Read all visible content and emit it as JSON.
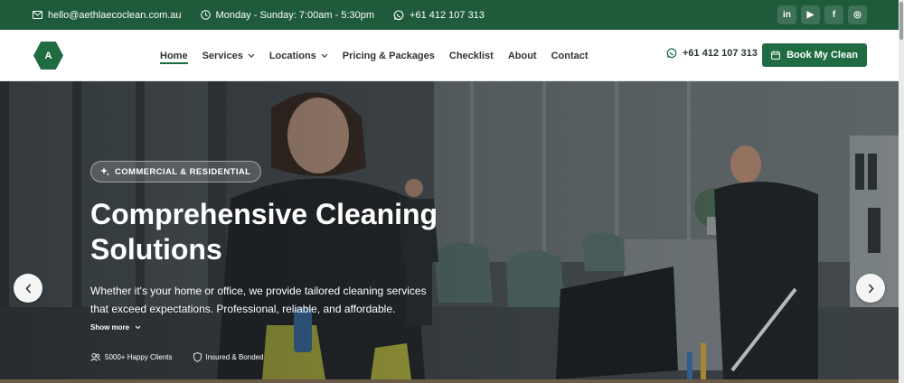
{
  "topbar": {
    "email": "hello@aethlaecoclean.com.au",
    "hours": "Monday - Sunday: 7:00am - 5:30pm",
    "phone": "+61 412 107 313",
    "socials": [
      {
        "name": "linkedin",
        "glyph": "in"
      },
      {
        "name": "youtube",
        "glyph": "▶"
      },
      {
        "name": "facebook",
        "glyph": "f"
      },
      {
        "name": "instagram",
        "glyph": "◎"
      }
    ]
  },
  "nav": {
    "logo_letter": "A",
    "items": [
      {
        "label": "Home",
        "active": true,
        "dropdown": false
      },
      {
        "label": "Services",
        "active": false,
        "dropdown": true
      },
      {
        "label": "Locations",
        "active": false,
        "dropdown": true
      },
      {
        "label": "Pricing & Packages",
        "active": false,
        "dropdown": false
      },
      {
        "label": "Checklist",
        "active": false,
        "dropdown": false
      },
      {
        "label": "About",
        "active": false,
        "dropdown": false
      },
      {
        "label": "Contact",
        "active": false,
        "dropdown": false
      }
    ],
    "phone": "+61 412 107 313",
    "cta_label": "Book My Clean"
  },
  "hero": {
    "badge": "COMMERCIAL & RESIDENTIAL",
    "title_line1": "Comprehensive Cleaning",
    "title_line2": "Solutions",
    "desc_line1": "Whether it's your home or office, we provide tailored cleaning services",
    "desc_line2": "that exceed expectations. Professional, reliable, and affordable.",
    "show_more": "Show more",
    "stat_clients": "5000+ Happy Clients",
    "stat_insured": "Insured & Bonded"
  },
  "colors": {
    "brand_green": "#1f6b42",
    "topbar_green": "#1f5a3b"
  }
}
